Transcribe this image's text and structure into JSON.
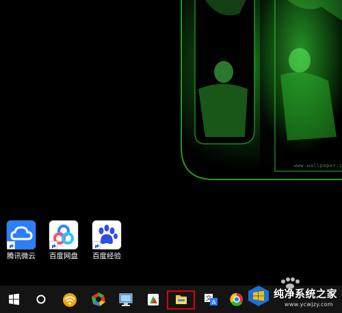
{
  "desktop": {
    "wallpaper_mark": "www.wallpaper.com",
    "icons": [
      {
        "label": "腾讯微云",
        "icon": "tencent-weiyun-icon"
      },
      {
        "label": "百度网盘",
        "icon": "baidu-netdisk-icon"
      },
      {
        "label": "百度经验",
        "icon": "baidu-jingyan-icon"
      }
    ]
  },
  "taskbar": {
    "buttons": [
      {
        "name": "start-button",
        "icon": "windows-logo-icon"
      },
      {
        "name": "cortana-button",
        "icon": "circle-search-icon"
      },
      {
        "name": "wifi-app-button",
        "icon": "wifi-app-icon"
      },
      {
        "name": "360-browser-button",
        "icon": "360-icon"
      },
      {
        "name": "computer-button",
        "icon": "computer-icon"
      },
      {
        "name": "media-button",
        "icon": "media-icon"
      },
      {
        "name": "file-explorer-button",
        "icon": "folder-icon"
      },
      {
        "name": "language-button",
        "icon": "translate-icon"
      },
      {
        "name": "chrome-button",
        "icon": "chrome-icon"
      }
    ],
    "highlighted": "file-explorer-button"
  },
  "watermark": {
    "name": "纯净系统之家",
    "url": "www.ycwjzy.com"
  },
  "colors": {
    "wallpaper_green": "#2ecc2e",
    "taskbar": "#141414",
    "highlight": "#e00000",
    "icon_blue": "#2d7ff9"
  }
}
